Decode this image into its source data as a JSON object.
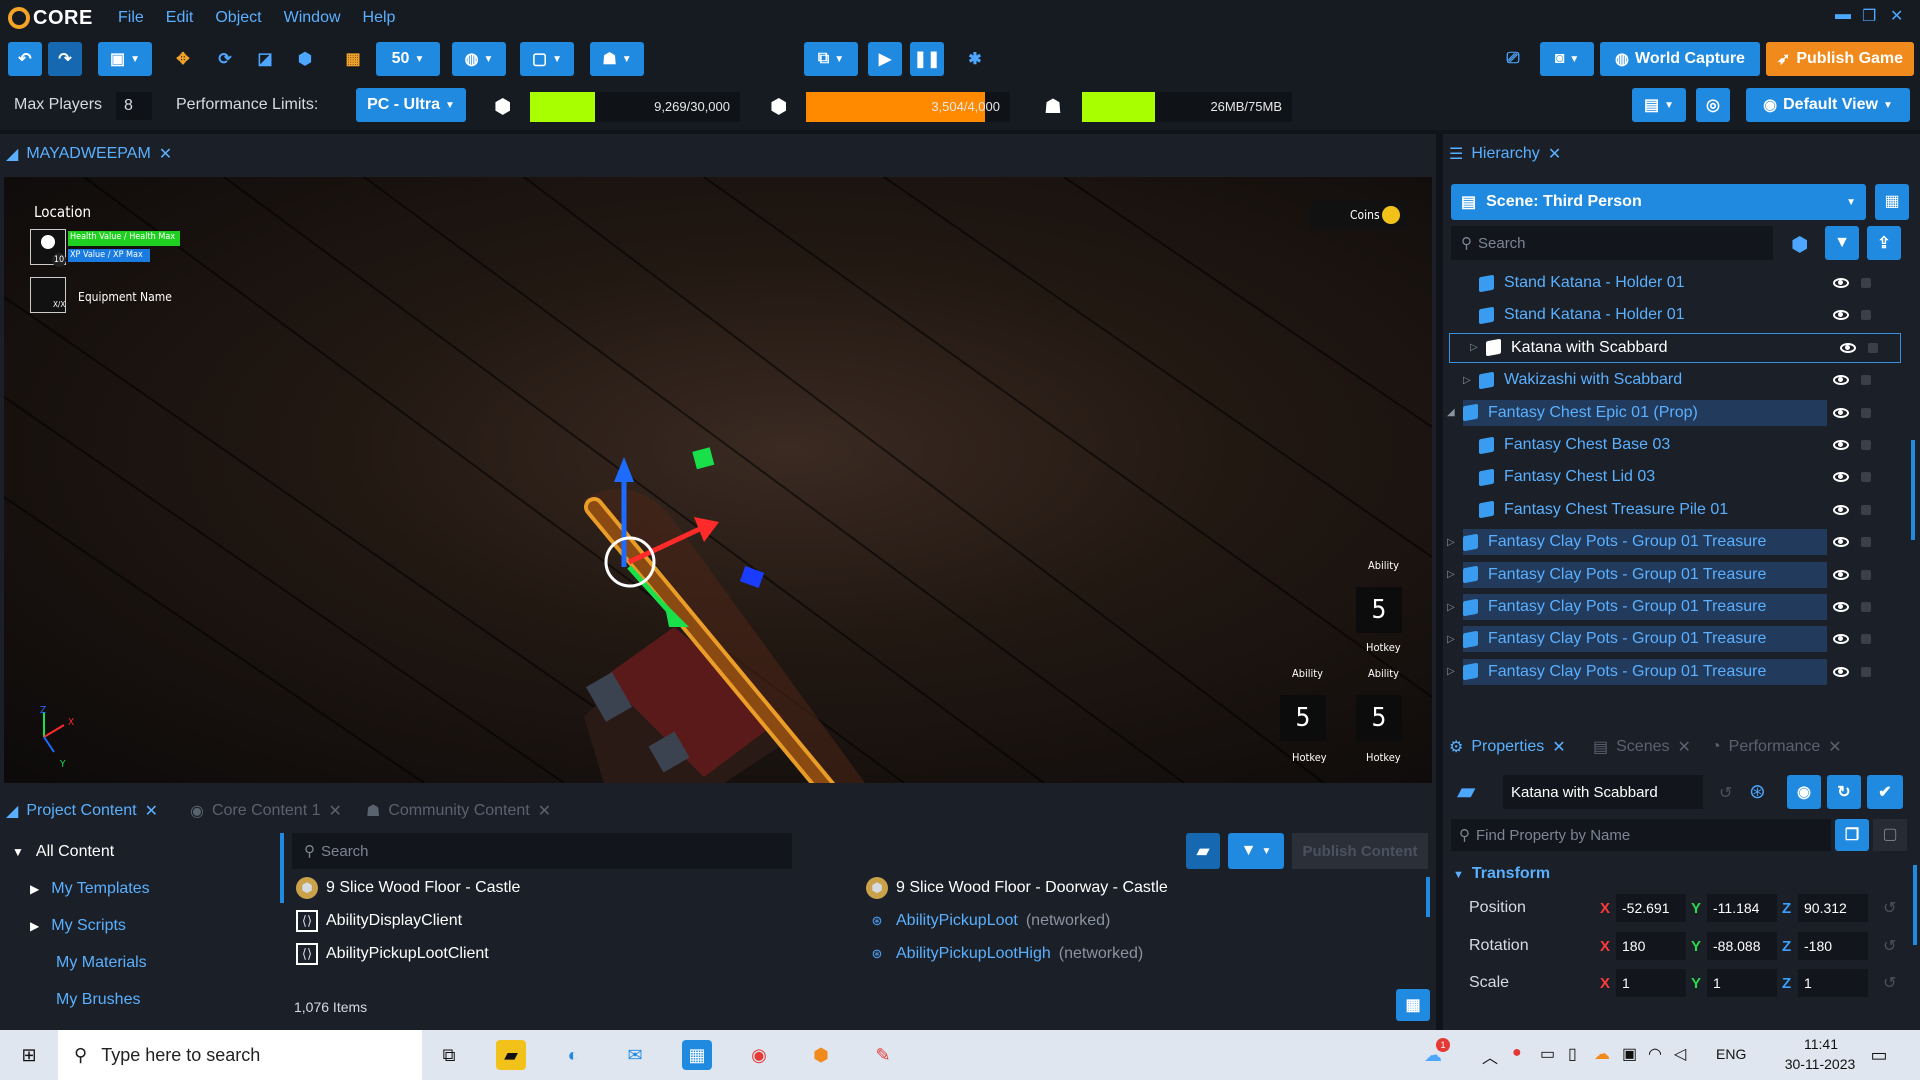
{
  "app": {
    "logo_text": "CORE"
  },
  "menu": [
    "File",
    "Edit",
    "Object",
    "Window",
    "Help"
  ],
  "toolbar": {
    "grid_size": "50",
    "world_capture_label": "World Capture",
    "publish_game_label": "Publish Game"
  },
  "perf": {
    "max_players_label": "Max Players",
    "max_players_value": "8",
    "limits_label": "Performance Limits:",
    "platform": "PC - Ultra",
    "objects": {
      "text": "9,269/30,000",
      "fraction": 0.309,
      "color": "#a8ff00"
    },
    "networked": {
      "text": "3,504/4,000",
      "fraction": 0.876,
      "color": "#ff8a00"
    },
    "memory": {
      "text": "26MB/75MB",
      "fraction": 0.347,
      "color": "#a8ff00"
    },
    "default_view_label": "Default View"
  },
  "viewport": {
    "tab_label": "MAYADWEEPAM",
    "hud": {
      "location": "Location",
      "health": "Health Value / Health Max",
      "xp": "XP Value / XP Max",
      "level": "10",
      "equipment_slot": "X/X",
      "equipment_name": "Equipment Name",
      "coins": "Coins",
      "ability_label": "Ability",
      "ability_number": "5",
      "hotkey_label": "Hotkey"
    },
    "gizmo_axes": {
      "x": "X",
      "y": "Y",
      "z": "Z"
    }
  },
  "hierarchy": {
    "tab_label": "Hierarchy",
    "scene_label": "Scene: Third Person",
    "search_placeholder": "Search",
    "items": [
      {
        "label": "Stand Katana - Holder 01",
        "indent": 2,
        "expander": "",
        "selected": false,
        "highlight": false
      },
      {
        "label": "Stand Katana - Holder 01",
        "indent": 2,
        "expander": "",
        "selected": false,
        "highlight": false
      },
      {
        "label": "Katana with Scabbard",
        "indent": 2,
        "expander": "▷",
        "selected": true,
        "highlight": false
      },
      {
        "label": "Wakizashi with Scabbard",
        "indent": 2,
        "expander": "▷",
        "selected": false,
        "highlight": false
      },
      {
        "label": "Fantasy Chest Epic 01 (Prop)",
        "indent": 1,
        "expander": "◢",
        "selected": false,
        "highlight": true
      },
      {
        "label": "Fantasy Chest Base 03",
        "indent": 2,
        "expander": "",
        "selected": false,
        "highlight": false
      },
      {
        "label": "Fantasy Chest Lid 03",
        "indent": 2,
        "expander": "",
        "selected": false,
        "highlight": false
      },
      {
        "label": "Fantasy Chest Treasure Pile 01",
        "indent": 2,
        "expander": "",
        "selected": false,
        "highlight": false
      },
      {
        "label": "Fantasy Clay Pots - Group 01 Treasure",
        "indent": 1,
        "expander": "▷",
        "selected": false,
        "highlight": true
      },
      {
        "label": "Fantasy Clay Pots - Group 01 Treasure",
        "indent": 1,
        "expander": "▷",
        "selected": false,
        "highlight": true
      },
      {
        "label": "Fantasy Clay Pots - Group 01 Treasure",
        "indent": 1,
        "expander": "▷",
        "selected": false,
        "highlight": true
      },
      {
        "label": "Fantasy Clay Pots - Group 01 Treasure",
        "indent": 1,
        "expander": "▷",
        "selected": false,
        "highlight": true
      },
      {
        "label": "Fantasy Clay Pots - Group 01 Treasure",
        "indent": 1,
        "expander": "▷",
        "selected": false,
        "highlight": true
      }
    ]
  },
  "properties": {
    "tabs": [
      "Properties",
      "Scenes",
      "Performance"
    ],
    "object_name": "Katana with Scabbard",
    "find_placeholder": "Find Property by Name",
    "section": "Transform",
    "position": {
      "label": "Position",
      "x": "-52.691",
      "y": "-11.184",
      "z": "90.312"
    },
    "rotation": {
      "label": "Rotation",
      "x": "180",
      "y": "-88.088",
      "z": "-180"
    },
    "scale": {
      "label": "Scale",
      "x": "1",
      "y": "1",
      "z": "1"
    }
  },
  "content": {
    "tabs": [
      "Project Content",
      "Core Content 1",
      "Community Content"
    ],
    "tree": [
      "All Content",
      "My Templates",
      "My Scripts",
      "My Materials",
      "My Brushes"
    ],
    "search_placeholder": "Search",
    "publish_label": "Publish Content",
    "items_left": [
      {
        "label": "9 Slice Wood Floor - Castle",
        "suffix": "",
        "icon": "template",
        "link": false
      },
      {
        "label": "AbilityDisplayClient",
        "suffix": "",
        "icon": "script",
        "link": false
      },
      {
        "label": "AbilityPickupLootClient",
        "suffix": "",
        "icon": "script",
        "link": false
      }
    ],
    "items_right": [
      {
        "label": "9 Slice Wood Floor - Doorway - Castle",
        "suffix": "",
        "icon": "template",
        "link": false
      },
      {
        "label": "AbilityPickupLoot",
        "suffix": "(networked)",
        "icon": "networked",
        "link": true
      },
      {
        "label": "AbilityPickupLootHigh",
        "suffix": "(networked)",
        "icon": "networked",
        "link": true
      }
    ],
    "count": "1,076 Items"
  },
  "taskbar": {
    "search_placeholder": "Type here to search",
    "lang": "ENG",
    "time": "11:41",
    "date": "30-11-2023",
    "weather_badge": "1"
  }
}
